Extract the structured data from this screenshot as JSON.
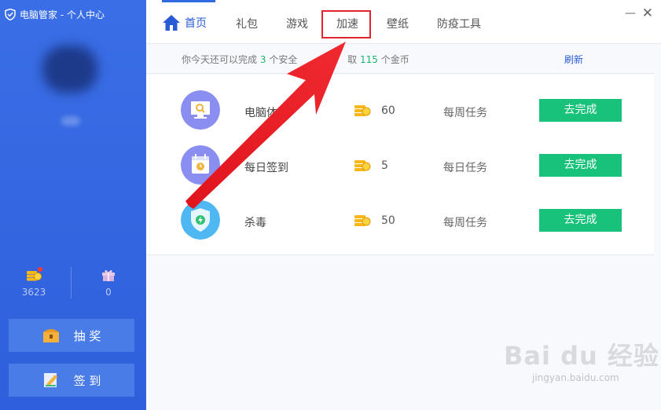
{
  "app": {
    "title": "电脑管家 - 个人中心"
  },
  "sidebar": {
    "coins": "3623",
    "gifts": "0",
    "lottery_label": "抽 奖",
    "signin_label": "签 到"
  },
  "tabs": {
    "home": "首页",
    "gift": "礼包",
    "game": "游戏",
    "speed": "加速",
    "wallpaper": "壁纸",
    "tools": "防疫工具"
  },
  "window": {
    "minimize": "—",
    "close": "✕"
  },
  "info": {
    "prefix": "你今天还可以完成",
    "count": "3",
    "middle": "个安全",
    "middle2": "取",
    "coins": "115",
    "suffix": "个金币",
    "refresh": "刷新"
  },
  "tasks": [
    {
      "name": "电脑体检",
      "coins": "60",
      "type": "每周任务",
      "button": "去完成",
      "icon": "monitor-scan-icon"
    },
    {
      "name": "每日签到",
      "coins": "5",
      "type": "每日任务",
      "button": "去完成",
      "icon": "calendar-icon"
    },
    {
      "name": "杀毒",
      "coins": "50",
      "type": "每周任务",
      "button": "去完成",
      "icon": "shield-bolt-icon"
    }
  ],
  "watermark": {
    "main": "Bai du 经验",
    "sub": "jingyan.baidu.com"
  },
  "colors": {
    "sidebar": "#3366e0",
    "accent": "#2f6be0",
    "green": "#19c27a",
    "highlight": "#e0242a"
  }
}
